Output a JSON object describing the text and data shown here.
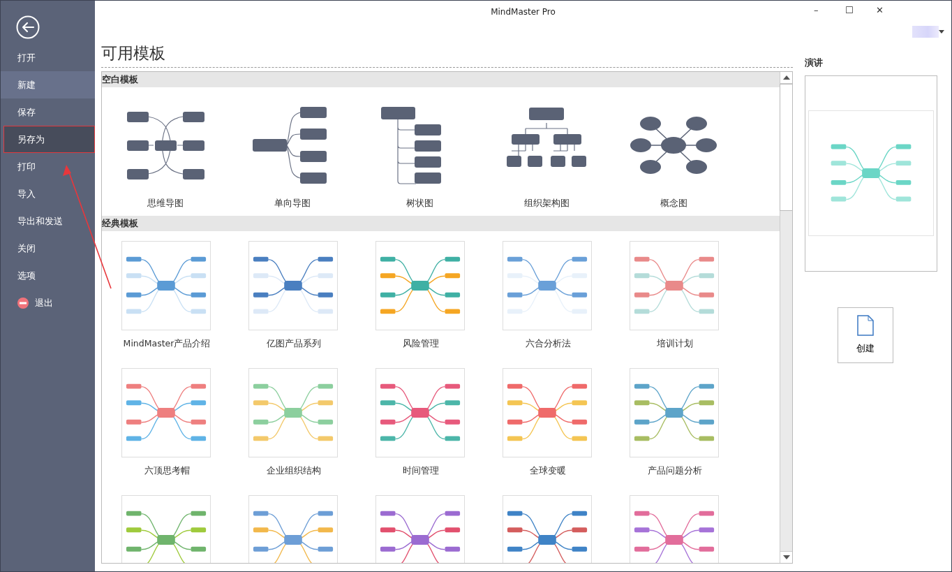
{
  "window": {
    "title": "MindMaster Pro",
    "controls": [
      "–",
      "☐",
      "✕"
    ]
  },
  "sidebar": {
    "items": [
      {
        "label": "打开",
        "selected": false,
        "highlighted": false,
        "kind": "plain"
      },
      {
        "label": "新建",
        "selected": true,
        "highlighted": false,
        "kind": "plain"
      },
      {
        "label": "保存",
        "selected": false,
        "highlighted": false,
        "kind": "plain"
      },
      {
        "label": "另存为",
        "selected": false,
        "highlighted": true,
        "kind": "plain"
      },
      {
        "label": "打印",
        "selected": false,
        "highlighted": false,
        "kind": "plain"
      },
      {
        "label": "导入",
        "selected": false,
        "highlighted": false,
        "kind": "plain"
      },
      {
        "label": "导出和发送",
        "selected": false,
        "highlighted": false,
        "kind": "plain"
      },
      {
        "label": "关闭",
        "selected": false,
        "highlighted": false,
        "kind": "plain"
      },
      {
        "label": "选项",
        "selected": false,
        "highlighted": false,
        "kind": "plain"
      },
      {
        "label": "退出",
        "selected": false,
        "highlighted": false,
        "kind": "exit"
      }
    ]
  },
  "heading": "可用模板",
  "sections": [
    {
      "title": "空白模板",
      "templates": [
        {
          "title": "思维导图",
          "kind": "mindmap"
        },
        {
          "title": "单向导图",
          "kind": "rightmap"
        },
        {
          "title": "树状图",
          "kind": "tree"
        },
        {
          "title": "组织架构图",
          "kind": "org"
        },
        {
          "title": "概念图",
          "kind": "concept"
        }
      ]
    },
    {
      "title": "经典模板",
      "templates": [
        {
          "title": "MindMaster产品介绍",
          "kind": "thumbnail"
        },
        {
          "title": "亿图产品系列",
          "kind": "thumbnail"
        },
        {
          "title": "风险管理",
          "kind": "thumbnail"
        },
        {
          "title": "六合分析法",
          "kind": "thumbnail"
        },
        {
          "title": "培训计划",
          "kind": "thumbnail"
        },
        {
          "title": "六顶思考帽",
          "kind": "thumbnail"
        },
        {
          "title": "企业组织结构",
          "kind": "thumbnail"
        },
        {
          "title": "时间管理",
          "kind": "thumbnail"
        },
        {
          "title": "全球变暖",
          "kind": "thumbnail"
        },
        {
          "title": "产品问题分析",
          "kind": "thumbnail"
        },
        {
          "kind": "picture"
        },
        {
          "kind": "picture"
        },
        {
          "kind": "picture"
        },
        {
          "kind": "picture"
        },
        {
          "kind": "picture"
        }
      ]
    }
  ],
  "preview": {
    "title": "演讲",
    "create_button": "创建"
  },
  "annotation": {
    "kind": "arrow"
  }
}
